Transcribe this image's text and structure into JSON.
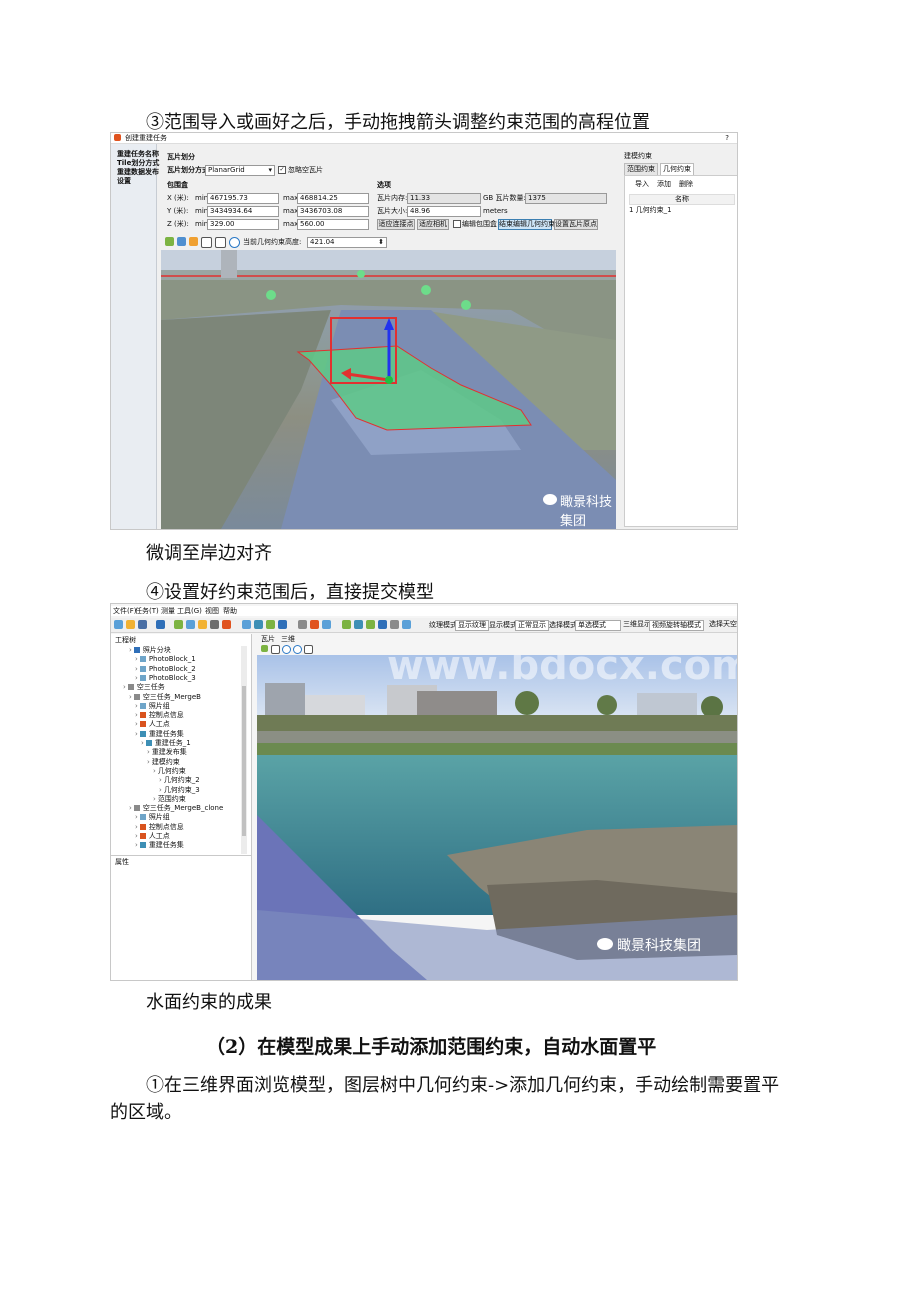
{
  "paragraphs": {
    "p1": "③范围导入或画好之后，手动拖拽箭头调整约束范围的高程位置",
    "p2": "微调至岸边对齐",
    "p3": "④设置好约束范围后，直接提交模型",
    "p4": "水面约束的成果",
    "heading": "（2）在模型成果上手动添加范围约束，自动水面置平",
    "p5a": "①在三维界面浏览模型，图层树中几何约束->添加几何约束，手动绘制需要置平",
    "p5b": "的区域。"
  },
  "screenshot1": {
    "window_title": "创建重建任务",
    "help": "?",
    "sidebar": [
      "重建任务名称",
      "Tile划分方式",
      "重建数据发布",
      "设置"
    ],
    "tile_section": "瓦片划分",
    "tile_mode_label": "瓦片划分方式",
    "tile_mode_value": "PlanarGrid",
    "ignore_empty": "忽略空瓦片",
    "bbox_label": "包围盒",
    "x_label": "X (米):",
    "y_label": "Y (米):",
    "z_label": "Z (米):",
    "min": "min",
    "max": "max",
    "x_min": "467195.73",
    "x_max": "468814.25",
    "y_min": "3434934.64",
    "y_max": "3436703.08",
    "z_min": "329.00",
    "z_max": "560.00",
    "options_label": "选项",
    "tile_mem_label": "瓦片内存:",
    "tile_mem_value": "11.33",
    "gb_label": "GB 瓦片数量:",
    "tile_count": "1375",
    "tile_size_label": "瓦片大小:",
    "tile_size_value": "48.96",
    "tile_size_unit": "meters",
    "btn1": "适应连接点",
    "btn2": "适应相机",
    "btn3": "编辑包围盒",
    "btn4": "结束编辑几何约束",
    "btn5": "设置瓦片原点",
    "elevation_label": "当前几何约束高度:",
    "elevation_value": "421.04",
    "right_panel_title": "建模约束",
    "tab_range": "范围约束",
    "tab_geo": "几何约束",
    "r_import": "导入",
    "r_add": "添加",
    "r_delete": "删除",
    "r_header": "名称",
    "r_row": "1  几何约束_1",
    "watermark": "瞰景科技集团"
  },
  "screenshot2": {
    "menu": [
      "文件(F)",
      "任务(T)",
      "测量",
      "工具(G)",
      "视图",
      "帮助"
    ],
    "toolbar_texts": [
      "纹理模式",
      "显示纹理",
      "显示模式",
      "正常显示",
      "选择模式",
      "单选模式",
      "三维显示模式",
      "视频旋转轴模式",
      "选择天空盒"
    ],
    "left_title": "工程树",
    "tree": [
      {
        "depth": 1,
        "label": "照片分块",
        "color": "#2f6fb8"
      },
      {
        "depth": 2,
        "label": "PhotoBlock_1",
        "color": "#6fa5c9"
      },
      {
        "depth": 2,
        "label": "PhotoBlock_2",
        "color": "#6fa5c9"
      },
      {
        "depth": 2,
        "label": "PhotoBlock_3",
        "color": "#6fa5c9"
      },
      {
        "depth": 0,
        "label": "空三任务",
        "color": "#8a8a8a"
      },
      {
        "depth": 1,
        "label": "空三任务_MergeB",
        "color": "#8a8a8a"
      },
      {
        "depth": 2,
        "label": "照片组",
        "color": "#6fa5c9"
      },
      {
        "depth": 2,
        "label": "控制点信息",
        "color": "#d9531e"
      },
      {
        "depth": 2,
        "label": "人工点",
        "color": "#d9531e"
      },
      {
        "depth": 2,
        "label": "重建任务集",
        "color": "#3d8fb5"
      },
      {
        "depth": 3,
        "label": "重建任务_1",
        "color": "#3d8fb5"
      },
      {
        "depth": 4,
        "label": "重建发布集",
        "color": ""
      },
      {
        "depth": 4,
        "label": "建模约束",
        "color": ""
      },
      {
        "depth": 5,
        "label": "几何约束",
        "color": ""
      },
      {
        "depth": 6,
        "label": "几何约束_2",
        "color": ""
      },
      {
        "depth": 6,
        "label": "几何约束_3",
        "color": ""
      },
      {
        "depth": 5,
        "label": "范围约束",
        "color": ""
      },
      {
        "depth": 1,
        "label": "空三任务_MergeB_clone",
        "color": "#8a8a8a"
      },
      {
        "depth": 2,
        "label": "照片组",
        "color": "#6fa5c9"
      },
      {
        "depth": 2,
        "label": "控制点信息",
        "color": "#d9531e"
      },
      {
        "depth": 2,
        "label": "人工点",
        "color": "#d9531e"
      },
      {
        "depth": 2,
        "label": "重建任务集",
        "color": "#3d8fb5"
      }
    ],
    "properties_title": "属性",
    "tab_tiles": "瓦片",
    "tab_3d": "三维",
    "watermark": "瞰景科技集团",
    "bg_watermark": "www.bdocx.com"
  }
}
